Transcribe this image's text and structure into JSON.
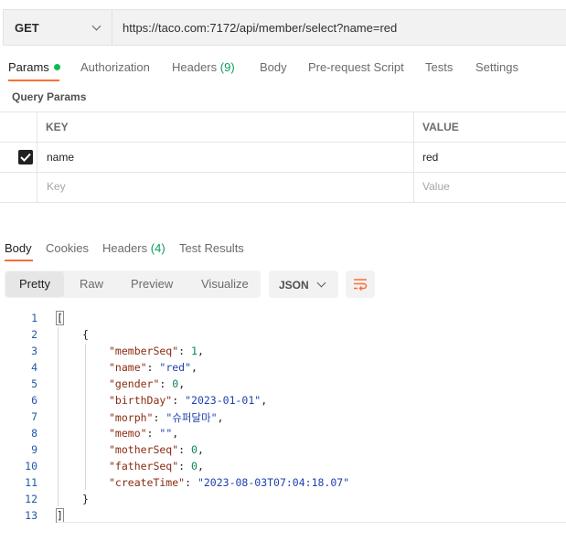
{
  "request": {
    "method": "GET",
    "url": "https://taco.com:7172/api/member/select?name=red"
  },
  "request_tabs": [
    {
      "label": "Params",
      "count": ""
    },
    {
      "label": "Authorization",
      "count": ""
    },
    {
      "label": "Headers",
      "count": "(9)"
    },
    {
      "label": "Body",
      "count": ""
    },
    {
      "label": "Pre-request Script",
      "count": ""
    },
    {
      "label": "Tests",
      "count": ""
    },
    {
      "label": "Settings",
      "count": ""
    }
  ],
  "query_params": {
    "title": "Query Params",
    "columns": [
      "KEY",
      "VALUE"
    ],
    "rows": [
      {
        "checked": true,
        "key": "name",
        "value": "red"
      }
    ],
    "placeholder": {
      "key": "Key",
      "value": "Value"
    }
  },
  "response_tabs": [
    {
      "label": "Body",
      "count": ""
    },
    {
      "label": "Cookies",
      "count": ""
    },
    {
      "label": "Headers",
      "count": "(4)"
    },
    {
      "label": "Test Results",
      "count": ""
    }
  ],
  "view_modes": [
    "Pretty",
    "Raw",
    "Preview",
    "Visualize"
  ],
  "format": "JSON",
  "response_body": [
    {
      "n": "1",
      "text": "["
    },
    {
      "n": "2",
      "text": "{"
    },
    {
      "n": "3",
      "k": "\"memberSeq\"",
      "v": "1",
      "t": "num"
    },
    {
      "n": "4",
      "k": "\"name\"",
      "v": "\"red\"",
      "t": "str"
    },
    {
      "n": "5",
      "k": "\"gender\"",
      "v": "0",
      "t": "num"
    },
    {
      "n": "6",
      "k": "\"birthDay\"",
      "v": "\"2023-01-01\"",
      "t": "str"
    },
    {
      "n": "7",
      "k": "\"morph\"",
      "v": "\"슈퍼달마\"",
      "t": "str"
    },
    {
      "n": "8",
      "k": "\"memo\"",
      "v": "\"\"",
      "t": "str"
    },
    {
      "n": "9",
      "k": "\"motherSeq\"",
      "v": "0",
      "t": "num"
    },
    {
      "n": "10",
      "k": "\"fatherSeq\"",
      "v": "0",
      "t": "num"
    },
    {
      "n": "11",
      "k": "\"createTime\"",
      "v": "\"2023-08-03T07:04:18.07\"",
      "t": "str",
      "last": true
    },
    {
      "n": "12",
      "text": "}"
    },
    {
      "n": "13",
      "text": "]"
    }
  ]
}
